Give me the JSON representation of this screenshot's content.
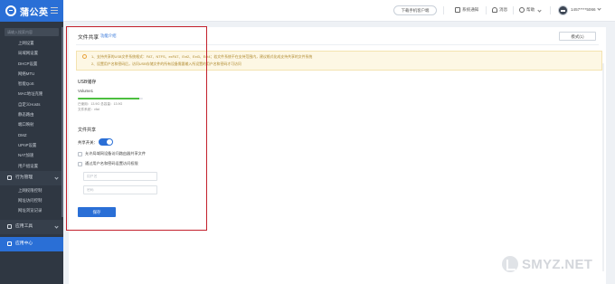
{
  "app": {
    "logo_text": "蒲公英"
  },
  "sidebar": {
    "search_placeholder": "请输入搜索内容",
    "items": [
      {
        "label": "上网设置"
      },
      {
        "label": "局域网设置"
      },
      {
        "label": "DHCP设置"
      },
      {
        "label": "网络MTU"
      },
      {
        "label": "智能QoS"
      },
      {
        "label": "MAC地址克隆"
      },
      {
        "label": "自定义Hosts"
      },
      {
        "label": "静态路由"
      },
      {
        "label": "端口映射"
      },
      {
        "label": "DMZ"
      },
      {
        "label": "UPnP设置"
      },
      {
        "label": "NAT加速"
      },
      {
        "label": "用户组设置"
      }
    ],
    "group_behavior": {
      "label": "行为管理"
    },
    "behavior_items": [
      {
        "label": "上网权限控制"
      },
      {
        "label": "网址访问控制"
      },
      {
        "label": "网址浏览记录"
      }
    ],
    "group_tools": {
      "label": "应用工具"
    },
    "group_apps": {
      "label": "应用中心"
    }
  },
  "topbar": {
    "download_label": "下载手机客户端",
    "notices_label": "系统通知",
    "messages_label": "消息",
    "help_label": "帮助",
    "account_label": "1457****5066"
  },
  "page": {
    "title": "文件共享",
    "help_link": "功能介绍",
    "mode_button": "模式(1)",
    "notice_lines": [
      "1、支持共享的USB文件系统格式：FAT、NTFS、exFAT、Ext2、Ext3、Ext4；若文件系统不在支持范围内，建议格式化成支持共享的文件系统",
      "2、设置用户名和密码后，访问USB存储文件的所有设备需要输入所设置的用户名和密码才可访问"
    ],
    "usb_section_title": "USB储存",
    "volume_name": "Volume1",
    "usage_percent": 0.95,
    "usage_text": "已使用：13.9G  总容量：13.9G",
    "fs_text": "文件系统：vfat",
    "share_section_title": "文件共享",
    "share_toggle_label": "共享开关：",
    "share_toggle_on": true,
    "checkbox_lan": "允许局域网设备访问路由器共享文件",
    "checkbox_auth": "通过用户名和密码设置访问权限",
    "username_placeholder": "用户名",
    "password_placeholder": "密码",
    "save_button": "保存"
  },
  "watermark": {
    "text": "SMYZ.NET"
  },
  "colors": {
    "accent": "#2a6fd6",
    "sidebar_bg": "#2f3742",
    "highlight": "#c3202c",
    "usage_bar": "#4cbf3f"
  }
}
